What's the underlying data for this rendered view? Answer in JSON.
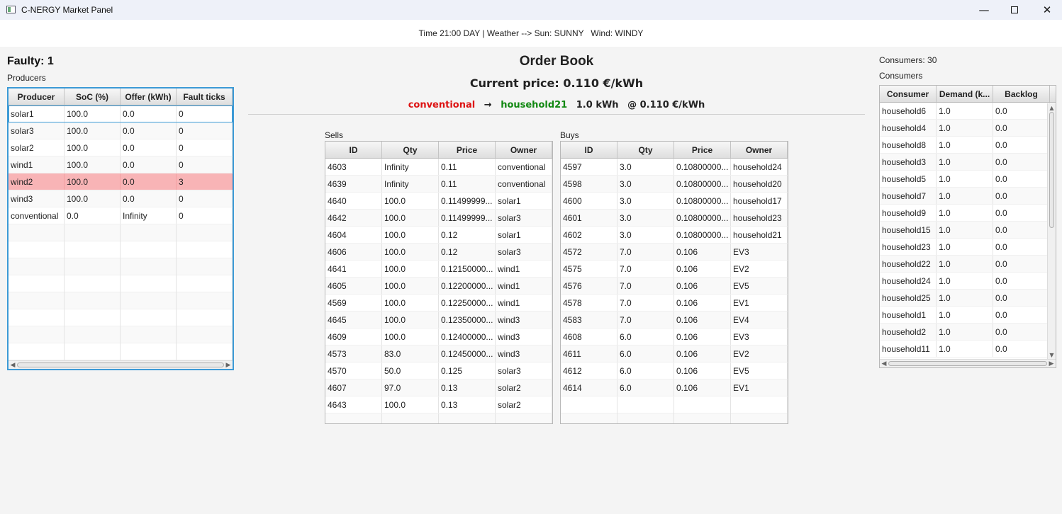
{
  "window": {
    "title": "C-NERGY Market Panel",
    "minimize_glyph": "—",
    "close_glyph": "✕"
  },
  "status": {
    "text": "Time 21:00 DAY | Weather --> Sun: SUNNY   Wind: WINDY"
  },
  "producers": {
    "faulty_label": "Faulty: 1",
    "caption": "Producers",
    "columns": [
      "Producer",
      "SoC (%)",
      "Offer (kWh)",
      "Fault ticks"
    ],
    "rows": [
      [
        "solar1",
        "100.0",
        "0.0",
        "0"
      ],
      [
        "solar3",
        "100.0",
        "0.0",
        "0"
      ],
      [
        "solar2",
        "100.0",
        "0.0",
        "0"
      ],
      [
        "wind1",
        "100.0",
        "0.0",
        "0"
      ],
      [
        "wind2",
        "100.0",
        "0.0",
        "3"
      ],
      [
        "wind3",
        "100.0",
        "0.0",
        "0"
      ],
      [
        "conventional",
        "0.0",
        "Infinity",
        "0"
      ]
    ],
    "faulty_row_color": "#f8b4b6"
  },
  "order_book": {
    "title": "Order Book",
    "current_price": "Current price: 0.110 €/kWh",
    "last_trade": {
      "seller": "conventional",
      "arrow": "→",
      "buyer": "household21",
      "qty": "1.0 kWh",
      "price": "@ 0.110 €/kWh"
    },
    "seller_color": "#dd1111",
    "buyer_color": "#118811",
    "sells": {
      "caption": "Sells",
      "columns": [
        "ID",
        "Qty",
        "Price",
        "Owner"
      ],
      "rows": [
        [
          "4603",
          "Infinity",
          "0.11",
          "conventional"
        ],
        [
          "4639",
          "Infinity",
          "0.11",
          "conventional"
        ],
        [
          "4640",
          "100.0",
          "0.11499999...",
          "solar1"
        ],
        [
          "4642",
          "100.0",
          "0.11499999...",
          "solar3"
        ],
        [
          "4604",
          "100.0",
          "0.12",
          "solar1"
        ],
        [
          "4606",
          "100.0",
          "0.12",
          "solar3"
        ],
        [
          "4641",
          "100.0",
          "0.12150000...",
          "wind1"
        ],
        [
          "4605",
          "100.0",
          "0.12200000...",
          "wind1"
        ],
        [
          "4569",
          "100.0",
          "0.12250000...",
          "wind1"
        ],
        [
          "4645",
          "100.0",
          "0.12350000...",
          "wind3"
        ],
        [
          "4609",
          "100.0",
          "0.12400000...",
          "wind3"
        ],
        [
          "4573",
          "83.0",
          "0.12450000...",
          "wind3"
        ],
        [
          "4570",
          "50.0",
          "0.125",
          "solar3"
        ],
        [
          "4607",
          "97.0",
          "0.13",
          "solar2"
        ],
        [
          "4643",
          "100.0",
          "0.13",
          "solar2"
        ]
      ]
    },
    "buys": {
      "caption": "Buys",
      "columns": [
        "ID",
        "Qty",
        "Price",
        "Owner"
      ],
      "rows": [
        [
          "4597",
          "3.0",
          "0.10800000...",
          "household24"
        ],
        [
          "4598",
          "3.0",
          "0.10800000...",
          "household20"
        ],
        [
          "4600",
          "3.0",
          "0.10800000...",
          "household17"
        ],
        [
          "4601",
          "3.0",
          "0.10800000...",
          "household23"
        ],
        [
          "4602",
          "3.0",
          "0.10800000...",
          "household21"
        ],
        [
          "4572",
          "7.0",
          "0.106",
          "EV3"
        ],
        [
          "4575",
          "7.0",
          "0.106",
          "EV2"
        ],
        [
          "4576",
          "7.0",
          "0.106",
          "EV5"
        ],
        [
          "4578",
          "7.0",
          "0.106",
          "EV1"
        ],
        [
          "4583",
          "7.0",
          "0.106",
          "EV4"
        ],
        [
          "4608",
          "6.0",
          "0.106",
          "EV3"
        ],
        [
          "4611",
          "6.0",
          "0.106",
          "EV2"
        ],
        [
          "4612",
          "6.0",
          "0.106",
          "EV5"
        ],
        [
          "4614",
          "6.0",
          "0.106",
          "EV1"
        ]
      ]
    }
  },
  "consumers": {
    "count_label": "Consumers: 30",
    "caption": "Consumers",
    "columns": [
      "Consumer",
      "Demand (k...",
      "Backlog"
    ],
    "rows": [
      [
        "household6",
        "1.0",
        "0.0"
      ],
      [
        "household4",
        "1.0",
        "0.0"
      ],
      [
        "household8",
        "1.0",
        "0.0"
      ],
      [
        "household3",
        "1.0",
        "0.0"
      ],
      [
        "household5",
        "1.0",
        "0.0"
      ],
      [
        "household7",
        "1.0",
        "0.0"
      ],
      [
        "household9",
        "1.0",
        "0.0"
      ],
      [
        "household15",
        "1.0",
        "0.0"
      ],
      [
        "household23",
        "1.0",
        "0.0"
      ],
      [
        "household22",
        "1.0",
        "0.0"
      ],
      [
        "household24",
        "1.0",
        "0.0"
      ],
      [
        "household25",
        "1.0",
        "0.0"
      ],
      [
        "household1",
        "1.0",
        "0.0"
      ],
      [
        "household2",
        "1.0",
        "0.0"
      ],
      [
        "household11",
        "1.0",
        "0.0"
      ]
    ]
  },
  "icons": {
    "app": "app-window-icon",
    "scroll_left": "◀",
    "scroll_right": "▶",
    "scroll_up": "▲",
    "scroll_down": "▼"
  }
}
